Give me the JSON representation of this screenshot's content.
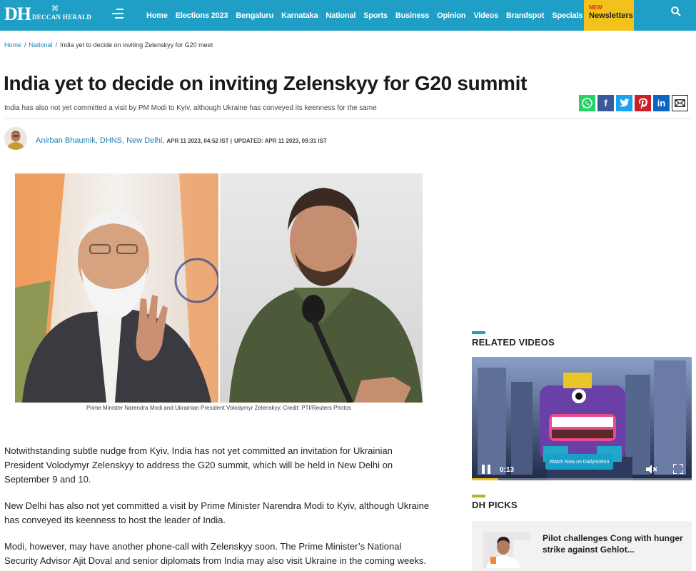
{
  "header": {
    "logo_letters": "DH",
    "logo_name": "DECCAN HERALD",
    "nav": [
      "Home",
      "Elections 2023",
      "Bengaluru",
      "Karnataka",
      "National",
      "Sports",
      "Business",
      "Opinion",
      "Videos",
      "Brandspot",
      "Specials"
    ],
    "newsletter_badge": "NEW",
    "newsletter_label": "Newsletters",
    "icons": {
      "menu": "hamburger-menu-icon",
      "search": "search-icon"
    },
    "colors": {
      "bar": "#1f9fc5",
      "newsletter": "#f3c21a"
    }
  },
  "breadcrumb": {
    "items": [
      "Home",
      "National"
    ],
    "current": "India yet to decide on inviting Zelenskyy for G20 meet"
  },
  "article": {
    "title": "India yet to decide on inviting Zelenskyy for G20 summit",
    "subtitle": "India has also not yet committed a visit by PM Modi to Kyiv, although Ukraine has conveyed its keenness for the same",
    "author": "Anirban Bhaumik, DHNS, New Delhi,",
    "published": "APR 11 2023, 04:52 IST |",
    "updated": "UPDATED: APR 11 2023, 09:31 IST",
    "image_caption": "Prime Minister Narendra Modi and Ukrainian President Volodymyr Zelenskyy. Credit: PTI/Reuters Photos",
    "paragraphs": [
      "Notwithstanding subtle nudge from Kyiv, India has not yet committed an invitation for Ukrainian President Volodymyr Zelenskyy to address the G20 summit, which will be held in New Delhi on September 9 and 10.",
      "New Delhi has also not yet committed a visit by Prime Minister Narendra Modi to Kyiv, although Ukraine has conveyed its keenness to host the leader of India.",
      "Modi, however, may have another phone-call with Zelenskyy soon. The Prime Minister’s National Security Advisor Ajit Doval and senior diplomats from India may also visit Ukraine in the coming weeks."
    ]
  },
  "share": [
    "whatsapp-icon",
    "facebook-icon",
    "twitter-icon",
    "pinterest-icon",
    "linkedin-icon",
    "email-icon"
  ],
  "sidebar": {
    "related_videos_title": "RELATED VIDEOS",
    "video_time": "0:13",
    "video_watch_label": "Watch Now on Dailymotion",
    "video_progress": 0.12,
    "dh_picks_title": "DH PICKS",
    "picks": [
      {
        "title": "Pilot challenges Cong with hunger strike against Gehlot..."
      }
    ],
    "accent_colors": {
      "related_videos": "#1f9fc5",
      "dh_picks": "#b7b02a"
    }
  }
}
